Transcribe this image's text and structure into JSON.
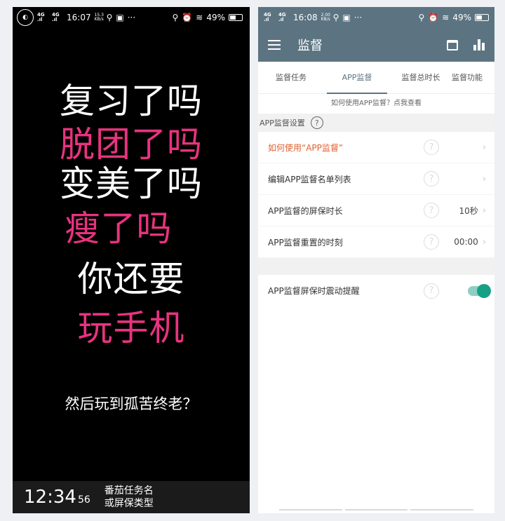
{
  "left": {
    "status": {
      "network": "4G",
      "signal": "4G",
      "time": "16:07",
      "speed": "15.3 KB/s",
      "battery": "49%"
    },
    "lines": [
      {
        "text": "复习了吗",
        "color": "white"
      },
      {
        "text": "脱团了吗",
        "color": "pink"
      },
      {
        "text": "变美了吗",
        "color": "white"
      },
      {
        "text": "瘦了吗",
        "color": "pink"
      },
      {
        "text": "你还要",
        "color": "white"
      },
      {
        "text": "玩手机",
        "color": "pink"
      }
    ],
    "subtitle": "然后玩到孤苦终老？",
    "bottom": {
      "clock": "12:34",
      "seconds": "56",
      "task_line1": "番茄任务名",
      "task_line2": "或屏保类型"
    }
  },
  "right": {
    "status": {
      "network": "4G",
      "signal": "4G",
      "time": "16:08",
      "speed": "2.00 KB/s",
      "battery": "49%"
    },
    "app_title": "监督",
    "tabs": [
      "监督任务",
      "APP监督",
      "监督总时长",
      "监督功能"
    ],
    "active_tab": 1,
    "hint": "如何使用APP监督？点我查看",
    "section_title": "APP监督设置",
    "help_glyph": "?",
    "rows": [
      {
        "label": "如何使用“APP监督”",
        "value": "",
        "chevron": true
      },
      {
        "label": "编辑APP监督名单列表",
        "value": "",
        "chevron": true
      },
      {
        "label": "APP监督的屏保时长",
        "value": "10秒",
        "chevron": true
      },
      {
        "label": "APP监督重置的时刻",
        "value": "00:00",
        "chevron": true
      }
    ],
    "toggle_row": {
      "label": "APP监督屏保时震动提醒",
      "enabled": true
    },
    "colors": {
      "primary": "#5c7482",
      "accent_orange": "#e0612f",
      "pink": "#e8337f",
      "toggle": "#17a086"
    }
  }
}
